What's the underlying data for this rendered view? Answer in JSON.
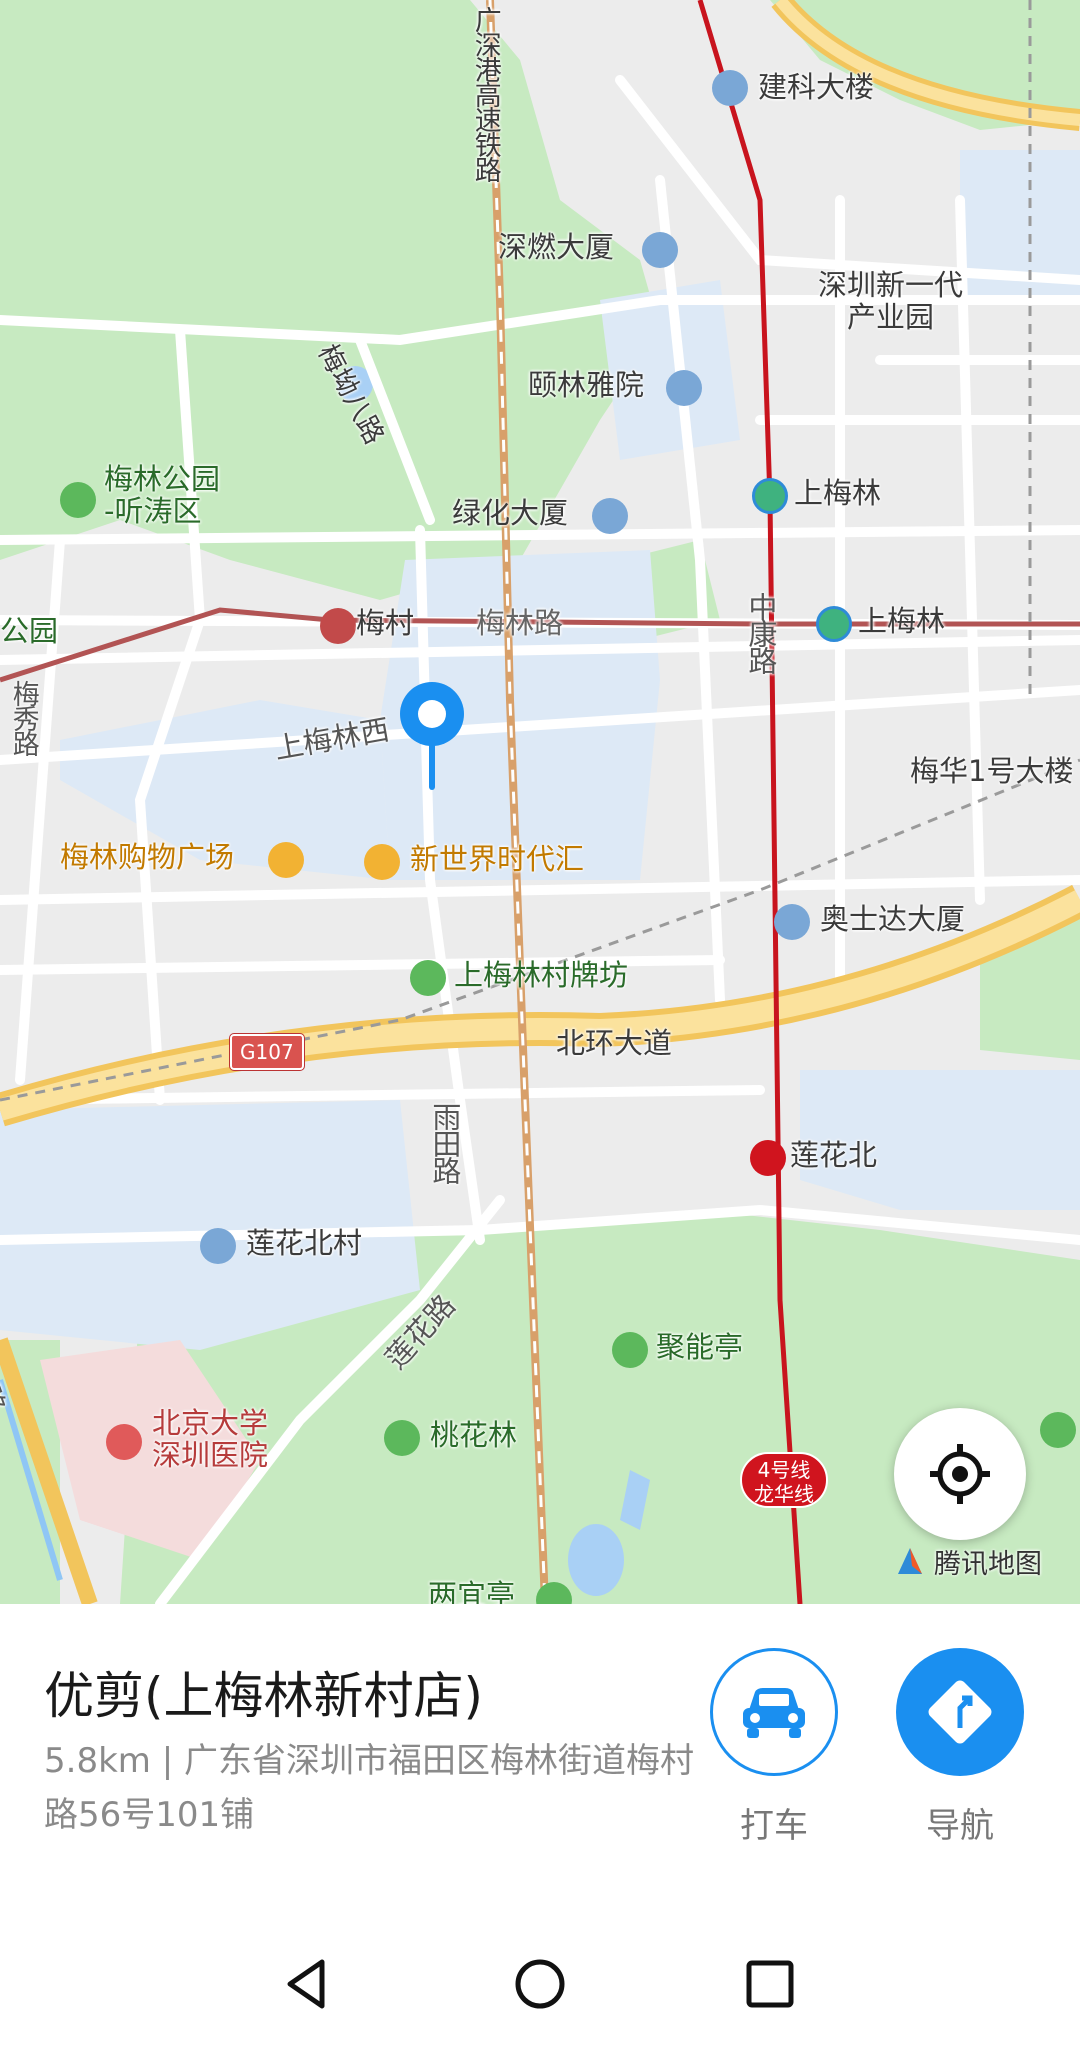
{
  "map": {
    "labels": {
      "jianke": "建科大楼",
      "shenzhen_hk_rail": "广深港高速铁路",
      "shenran": "深燃大厦",
      "new_gen_park": "深圳新一代\n产业园",
      "meisi_rd": "梅坳八路",
      "yilin": "颐林雅院",
      "meilin_park": "梅林公园\n-听涛区",
      "lvhua": "绿化大厦",
      "shangmeilin_1": "上梅林",
      "park_edge": "公园",
      "meicun": "梅村",
      "meilin_rd": "梅林路",
      "zhongkang_rd": "中康路",
      "shangmeilin_2": "上梅林",
      "meixiu_rd": "梅秀路",
      "shangmeilin_west": "上梅林西",
      "meihua": "梅华1号大楼",
      "meilin_mall": "梅林购物广场",
      "new_world": "新世界时代汇",
      "aoshida": "奥士达大厦",
      "paifang": "上梅林村牌坊",
      "g107": "G107",
      "beihuan": "北环大道",
      "yutian_rd": "雨田路",
      "lianhuabei": "莲花北",
      "lianhuabei_village": "莲花北村",
      "lianhua_rd": "莲花路",
      "juneng": "聚能亭",
      "pku_hospital": "北京大学\n深圳医院",
      "taohualin": "桃花林",
      "line4": "4号线\n龙华线",
      "liangyi": "两宜亭",
      "left_rd": "路"
    },
    "brand": "腾讯地图",
    "locate_icon": "crosshair-icon",
    "pin_color": "#1a8ff0"
  },
  "place": {
    "name": "优剪(上梅林新村店)",
    "address": "5.8km | 广东省深圳市福田区梅林街道梅村路56号101铺"
  },
  "actions": {
    "taxi": {
      "label": "打车",
      "icon": "car-icon",
      "color": "#1a8ff0"
    },
    "navigate": {
      "label": "导航",
      "icon": "navigation-icon",
      "color": "#1a8ff0"
    }
  },
  "system_nav": {
    "back": "back-triangle-icon",
    "home": "home-circle-icon",
    "recents": "recents-square-icon"
  }
}
